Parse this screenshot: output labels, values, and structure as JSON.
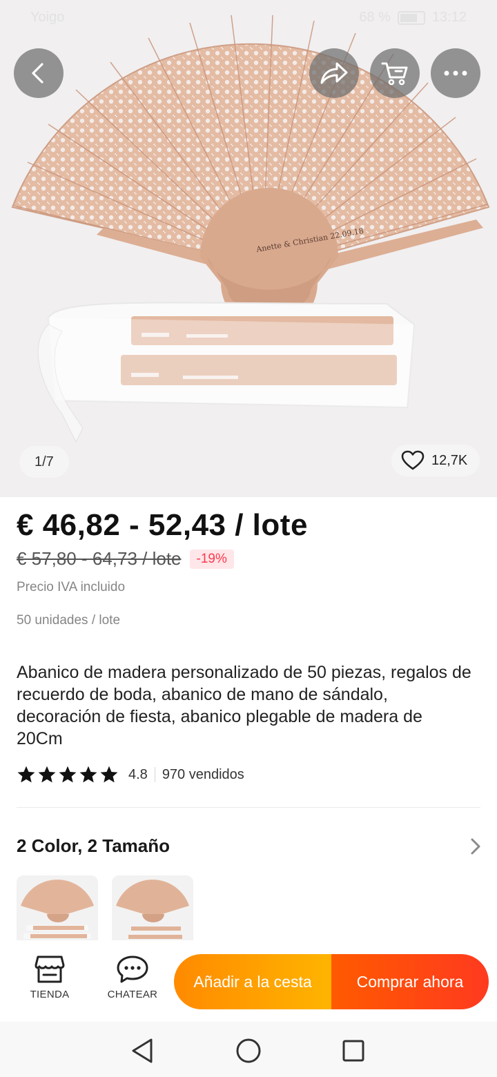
{
  "status_bar": {
    "carrier": "Yoigo",
    "battery": "68 %",
    "time": "13:12"
  },
  "gallery": {
    "image_text": "Anette & Christian 22.09.18",
    "counter": "1/7",
    "likes": "12,7K"
  },
  "icons": {
    "back": "back-arrow-icon",
    "share": "share-icon",
    "cart": "cart-icon",
    "more": "more-icon",
    "heart": "heart-icon",
    "star": "star-icon",
    "chevron": "chevron-right-icon",
    "store": "store-icon",
    "chat": "chat-icon"
  },
  "product": {
    "price": "€ 46,82 - 52,43 / lote",
    "old_price": "€ 57,80 - 64,73 / lote",
    "discount": "-19%",
    "tax_note": "Precio IVA incluido",
    "units": "50 unidades / lote",
    "title": "Abanico de madera personalizado de 50 piezas, regalos de recuerdo de boda, abanico de mano de sándalo, decoración de fiesta, abanico plegable de madera de 20Cm",
    "rating": 4.8,
    "rating_label": "4.8",
    "sold": "970 vendidos"
  },
  "variants": {
    "title": "2 Color, 2 Tamaño"
  },
  "actions": {
    "store_label": "TIENDA",
    "chat_label": "CHATEAR",
    "add_to_cart": "Añadir a la cesta",
    "buy_now": "Comprar ahora"
  },
  "colors": {
    "price_text": "#111111",
    "discount_text": "#fd384f",
    "add_button": "#ff9a00",
    "buy_button": "#ff4a10",
    "fan_wood": "#e0b49a"
  }
}
